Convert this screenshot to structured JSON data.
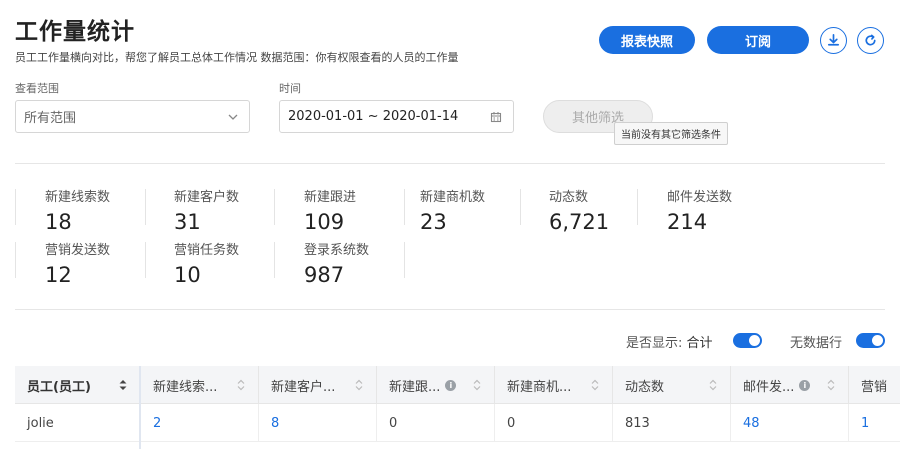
{
  "header": {
    "title": "工作量统计",
    "subtitle": "员工工作量横向对比，帮您了解员工总体工作情况 数据范围：你有权限查看的人员的工作量",
    "snapshot_label": "报表快照",
    "subscribe_label": "订阅",
    "accent_color": "#1a6fe0"
  },
  "filters": {
    "scope_label": "查看范围",
    "scope_value": "所有范围",
    "time_label": "时间",
    "time_value": "2020-01-01 ~ 2020-01-14",
    "other_filter_label": "其他筛选",
    "other_filter_tooltip": "当前没有其它筛选条件"
  },
  "stats": [
    {
      "label": "新建线索数",
      "value": "18"
    },
    {
      "label": "新建客户数",
      "value": "31"
    },
    {
      "label": "新建跟进",
      "value": "109"
    },
    {
      "label": "新建商机数",
      "value": "23"
    },
    {
      "label": "动态数",
      "value": "6,721"
    },
    {
      "label": "邮件发送数",
      "value": "214"
    },
    {
      "label": "营销发送数",
      "value": "12"
    },
    {
      "label": "营销任务数",
      "value": "10"
    },
    {
      "label": "登录系统数",
      "value": "987"
    }
  ],
  "display": {
    "show_label": "是否显示:",
    "total_label": "合计",
    "total_on": true,
    "no_data_rows_label": "无数据行",
    "no_data_rows_on": true
  },
  "table": {
    "columns": [
      "员工(员工)",
      "新建线索...",
      "新建客户...",
      "新建跟...",
      "新建商机...",
      "动态数",
      "邮件发...",
      "营销"
    ],
    "rows": [
      [
        "jolie",
        "2",
        "8",
        "0",
        "0",
        "813",
        "48",
        "1"
      ]
    ]
  }
}
